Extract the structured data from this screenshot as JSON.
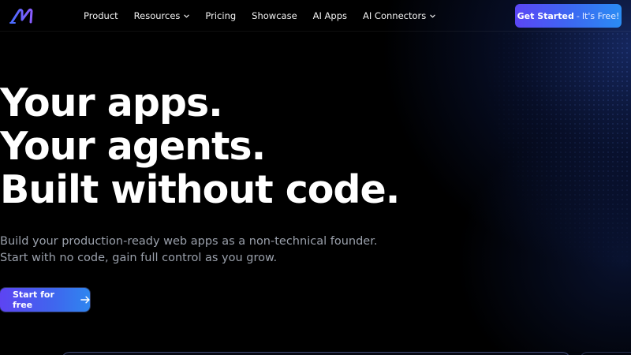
{
  "nav": {
    "logo_icon": "brand-logo-icon",
    "items": [
      {
        "label": "Product",
        "has_dropdown": false
      },
      {
        "label": "Resources",
        "has_dropdown": true
      },
      {
        "label": "Pricing",
        "has_dropdown": false
      },
      {
        "label": "Showcase",
        "has_dropdown": false
      },
      {
        "label": "AI Apps",
        "has_dropdown": false
      },
      {
        "label": "AI Connectors",
        "has_dropdown": true
      }
    ],
    "cta": {
      "strong": "Get Started",
      "separator": "-",
      "light": "It's Free!"
    }
  },
  "hero": {
    "title_lines": [
      "Your apps.",
      "Your agents.",
      "Built without code."
    ],
    "subtitle_lines": [
      "Build your production-ready web apps as a non-technical founder.",
      "Start with no code, gain full control as you grow."
    ],
    "button_label": "Start for free",
    "button_icon": "arrow-right-icon"
  },
  "colors": {
    "background": "#000000",
    "accent_start": "#5b46f5",
    "accent_end": "#2a8cf3",
    "subtitle": "#9aa0ab"
  }
}
